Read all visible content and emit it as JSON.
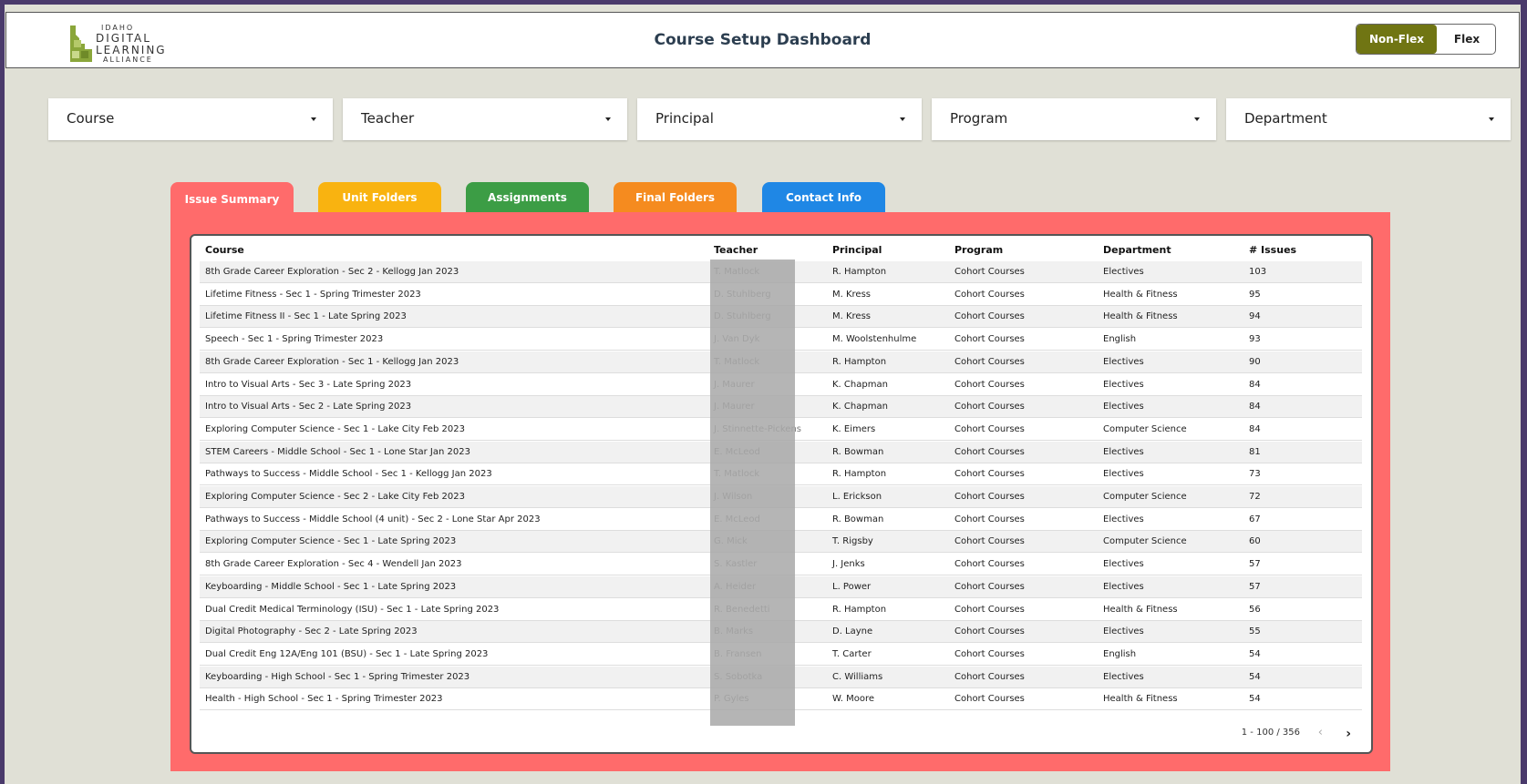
{
  "header": {
    "logo": {
      "line1": "IDAHO",
      "line2": "DIGITAL",
      "line3": "LEARNING",
      "line4": "ALLIANCE"
    },
    "title": "Course Setup Dashboard",
    "toggle": {
      "on": "Non-Flex",
      "off": "Flex"
    }
  },
  "filters": [
    "Course",
    "Teacher",
    "Principal",
    "Program",
    "Department"
  ],
  "tabs": [
    {
      "label": "Issue Summary",
      "color": "#ff6b6b"
    },
    {
      "label": "Unit Folders",
      "color": "#f9b310"
    },
    {
      "label": "Assignments",
      "color": "#3c9d45"
    },
    {
      "label": "Final Folders",
      "color": "#f58b1f"
    },
    {
      "label": "Contact Info",
      "color": "#1f87e5"
    }
  ],
  "table": {
    "columns": [
      "Course",
      "Teacher",
      "Principal",
      "Program",
      "Department",
      "# Issues"
    ],
    "rows": [
      [
        "8th Grade Career Exploration - Sec 2 - Kellogg Jan 2023",
        "T. Matlock",
        "R. Hampton",
        "Cohort Courses",
        "Electives",
        "103"
      ],
      [
        "Lifetime Fitness - Sec 1 - Spring Trimester 2023",
        "D. Stuhlberg",
        "M. Kress",
        "Cohort Courses",
        "Health & Fitness",
        "95"
      ],
      [
        "Lifetime Fitness II - Sec 1 - Late Spring 2023",
        "D. Stuhlberg",
        "M. Kress",
        "Cohort Courses",
        "Health & Fitness",
        "94"
      ],
      [
        "Speech - Sec 1 - Spring Trimester 2023",
        "J. Van Dyk",
        "M. Woolstenhulme",
        "Cohort Courses",
        "English",
        "93"
      ],
      [
        "8th Grade Career Exploration - Sec 1 - Kellogg Jan 2023",
        "T. Matlock",
        "R. Hampton",
        "Cohort Courses",
        "Electives",
        "90"
      ],
      [
        "Intro to Visual Arts - Sec 3 - Late Spring 2023",
        "J. Maurer",
        "K. Chapman",
        "Cohort Courses",
        "Electives",
        "84"
      ],
      [
        "Intro to Visual Arts - Sec 2 - Late Spring 2023",
        "J. Maurer",
        "K. Chapman",
        "Cohort Courses",
        "Electives",
        "84"
      ],
      [
        "Exploring Computer Science - Sec 1 - Lake City Feb 2023",
        "J. Stinnette-Pickens",
        "K. Eimers",
        "Cohort Courses",
        "Computer Science",
        "84"
      ],
      [
        "STEM Careers - Middle School - Sec 1 - Lone Star Jan 2023",
        "E. McLeod",
        "R. Bowman",
        "Cohort Courses",
        "Electives",
        "81"
      ],
      [
        "Pathways to Success - Middle School - Sec 1 - Kellogg Jan 2023",
        "T. Matlock",
        "R. Hampton",
        "Cohort Courses",
        "Electives",
        "73"
      ],
      [
        "Exploring Computer Science - Sec 2 - Lake City Feb 2023",
        "J. Wilson",
        "L. Erickson",
        "Cohort Courses",
        "Computer Science",
        "72"
      ],
      [
        "Pathways to Success - Middle School (4 unit) - Sec 2 - Lone Star Apr 2023",
        "E. McLeod",
        "R. Bowman",
        "Cohort Courses",
        "Electives",
        "67"
      ],
      [
        "Exploring Computer Science - Sec 1 - Late Spring 2023",
        "G. Mick",
        "T. Rigsby",
        "Cohort Courses",
        "Computer Science",
        "60"
      ],
      [
        "8th Grade Career Exploration - Sec 4 - Wendell Jan 2023",
        "S. Kastler",
        "J. Jenks",
        "Cohort Courses",
        "Electives",
        "57"
      ],
      [
        "Keyboarding - Middle School - Sec 1 - Late Spring 2023",
        "A. Heider",
        "L. Power",
        "Cohort Courses",
        "Electives",
        "57"
      ],
      [
        "Dual Credit Medical Terminology (ISU) - Sec 1 - Late Spring 2023",
        "R. Benedetti",
        "R. Hampton",
        "Cohort Courses",
        "Health & Fitness",
        "56"
      ],
      [
        "Digital Photography - Sec 2 - Late Spring 2023",
        "B. Marks",
        "D. Layne",
        "Cohort Courses",
        "Electives",
        "55"
      ],
      [
        "Dual Credit Eng 12A/Eng 101 (BSU) - Sec 1 - Late Spring 2023",
        "B. Fransen",
        "T. Carter",
        "Cohort Courses",
        "English",
        "54"
      ],
      [
        "Keyboarding - High School - Sec 1 - Spring Trimester 2023",
        "S. Sobotka",
        "C. Williams",
        "Cohort Courses",
        "Electives",
        "54"
      ],
      [
        "Health - High School - Sec 1 - Spring Trimester 2023",
        "P. Gyles",
        "W. Moore",
        "Cohort Courses",
        "Health & Fitness",
        "54"
      ]
    ]
  },
  "pagination": {
    "label": "1 - 100 / 356",
    "prev_icon": "chevron-left-icon",
    "next_icon": "chevron-right-icon"
  }
}
